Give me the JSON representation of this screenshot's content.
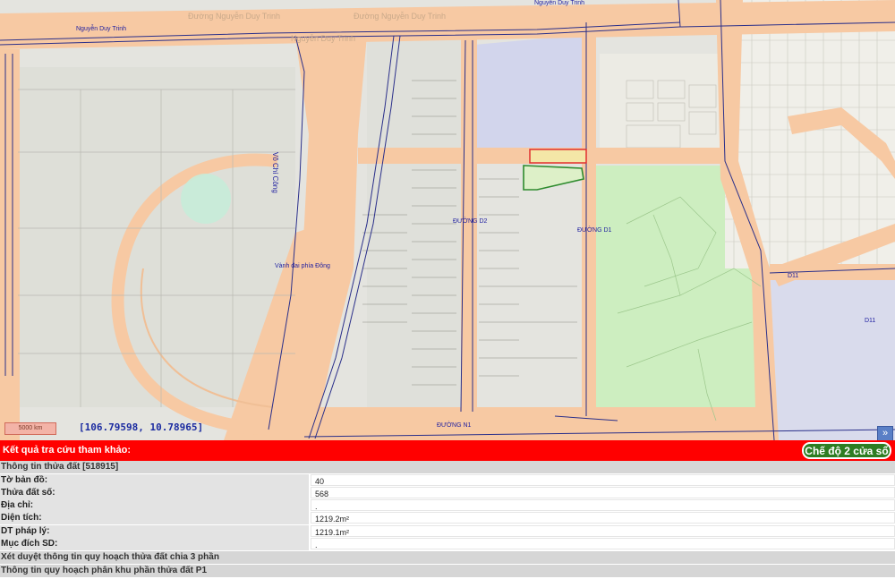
{
  "map": {
    "road_labels": {
      "nguyen_duy_trinh_left": "Nguyễn Duy Trinh",
      "nguyen_duy_trinh_top": "Nguyễn Duy Trinh",
      "nguyen_duy_trinh_faded1": "Đường Nguyễn Duy Trinh",
      "nguyen_duy_trinh_faded2": "Đường Nguyễn Duy Trinh",
      "nguyen_duy_trinh_faded3": "Nguyễn Duy Trinh",
      "vo_chi_cong": "Võ Chí Công",
      "vanh_dai_phia_dong": "Vành đai phía Đông",
      "duong_d2": "ĐƯỜNG D2",
      "duong_d1": "ĐƯỜNG D1",
      "duong_n1": "ĐƯỜNG N1",
      "d11_a": "D11",
      "d11_b": "D11"
    },
    "scale_label": "5000 km",
    "coordinates": "[106.79598, 10.78965]",
    "expand_icon_glyph": "»"
  },
  "panel": {
    "title": "Kết quả tra cứu tham khảo:",
    "mode_button": "Chế độ 2 cửa sổ",
    "parcel_section": "Thông tin thửa đất [518915]",
    "fields": [
      {
        "label": "Tờ bản đồ:",
        "value": "40"
      },
      {
        "label": "Thửa đất số:",
        "value": "568"
      },
      {
        "label": "Địa chỉ:",
        "value": "."
      },
      {
        "label": "Diện tích:",
        "value": "1219.2m²"
      },
      {
        "label": "DT pháp lý:",
        "value": "1219.1m²"
      },
      {
        "label": "Mục đích SD:",
        "value": "."
      }
    ],
    "section_3part": "Xét duyệt thông tin quy hoạch thửa đất chia 3 phần",
    "section_p1": "Thông tin quy hoạch phân khu phần thửa đất P1"
  },
  "colors": {
    "road_fill": "#f7c9a3",
    "park_green": "#cdeec0",
    "residential_blue": "#d0d3ee",
    "selected_parcel": "#e03030",
    "header_red": "#ff0000",
    "mode_button_green": "#2e7d22"
  }
}
